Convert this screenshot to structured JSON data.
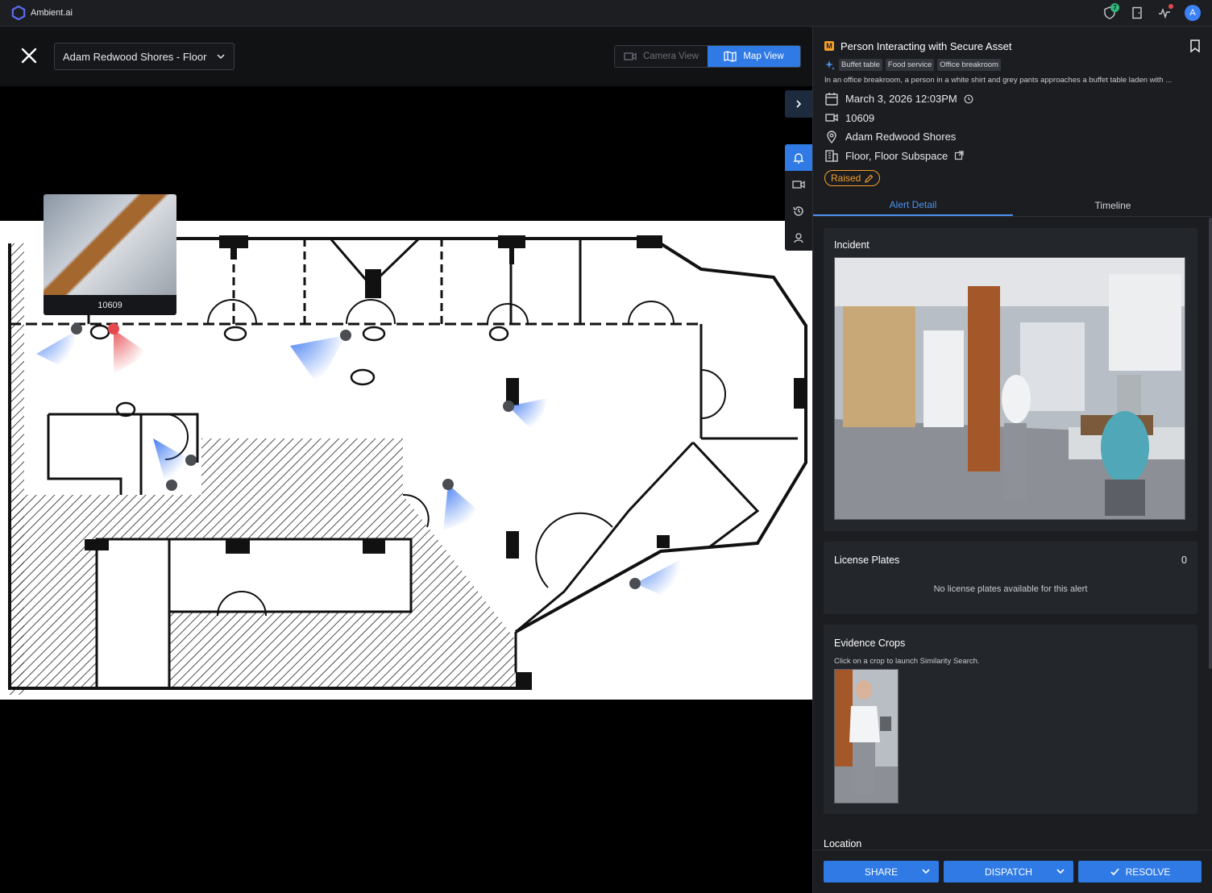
{
  "app": {
    "brand": "Ambient.ai",
    "accent": "#2f7ae5",
    "shield_count": "7",
    "avatar_initial": "A"
  },
  "toolbar": {
    "floor_select": "Adam Redwood Shores - Floor",
    "camera_view_label": "Camera View",
    "map_view_label": "Map View"
  },
  "map": {
    "camera_thumb_label": "10609"
  },
  "alert": {
    "severity": "M",
    "severity_color": "#f59f2b",
    "title": "Person Interacting with Secure Asset",
    "tags": [
      "Buffet table",
      "Food service",
      "Office breakroom"
    ],
    "description": "In an office breakroom, a person in a white shirt and grey pants approaches a buffet table laden with ...",
    "datetime": "March 3, 2026 12:03PM",
    "camera_id": "10609",
    "site": "Adam Redwood Shores",
    "area": "Floor, Floor Subspace",
    "status": "Raised"
  },
  "tabs": {
    "detail": "Alert Detail",
    "timeline": "Timeline"
  },
  "incident": {
    "title": "Incident"
  },
  "plates": {
    "title": "License Plates",
    "count": "0",
    "empty": "No license plates available for this alert"
  },
  "evidence": {
    "title": "Evidence Crops",
    "hint": "Click on a crop to launch Similarity Search."
  },
  "location": {
    "title": "Location"
  },
  "actions": {
    "share": "SHARE",
    "dispatch": "DISPATCH",
    "resolve": "RESOLVE"
  }
}
